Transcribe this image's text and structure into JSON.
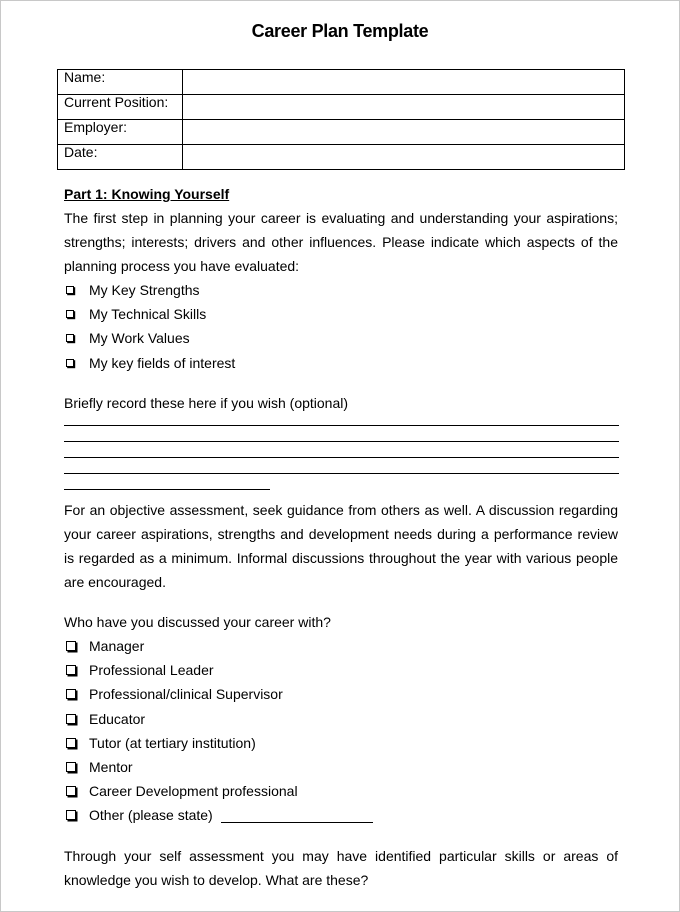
{
  "document": {
    "title": "Career Plan Template",
    "info_table": [
      {
        "label": "Name:",
        "value": ""
      },
      {
        "label": "Current Position:",
        "value": ""
      },
      {
        "label": "Employer:",
        "value": ""
      },
      {
        "label": "Date:",
        "value": ""
      }
    ],
    "part1": {
      "heading": "Part 1:  Knowing Yourself",
      "intro": "The first step in planning your career is evaluating and understanding your aspirations; strengths; interests; drivers and other influences.  Please indicate which aspects of the planning process you have evaluated:",
      "checklist": [
        {
          "label": "My Key Strengths",
          "checked": false
        },
        {
          "label": "My Technical Skills",
          "checked": false
        },
        {
          "label": "My Work Values",
          "checked": false
        },
        {
          "label": "My key fields of interest",
          "checked": false
        }
      ],
      "record_prompt": "Briefly record these here if you wish (optional)",
      "assessment_text": "For an objective assessment, seek guidance from others as well.  A discussion regarding your career aspirations, strengths and development needs during a performance review is regarded as a minimum.  Informal discussions throughout the year with various people are encouraged.",
      "discussed_prompt": "Who have you discussed your career with?",
      "discussed_list": [
        {
          "label": "Manager",
          "checked": false
        },
        {
          "label": "Professional Leader",
          "checked": false
        },
        {
          "label": "Professional/clinical Supervisor",
          "checked": false
        },
        {
          "label": "Educator",
          "checked": false
        },
        {
          "label": "Tutor (at tertiary institution)",
          "checked": false
        },
        {
          "label": "Mentor",
          "checked": false
        },
        {
          "label": "Career Development professional",
          "checked": false
        },
        {
          "label": "Other (please state)",
          "checked": false
        }
      ],
      "develop_prompt": "Through your self assessment you may have identified particular skills or areas of knowledge you wish to develop.  What are these?"
    }
  }
}
